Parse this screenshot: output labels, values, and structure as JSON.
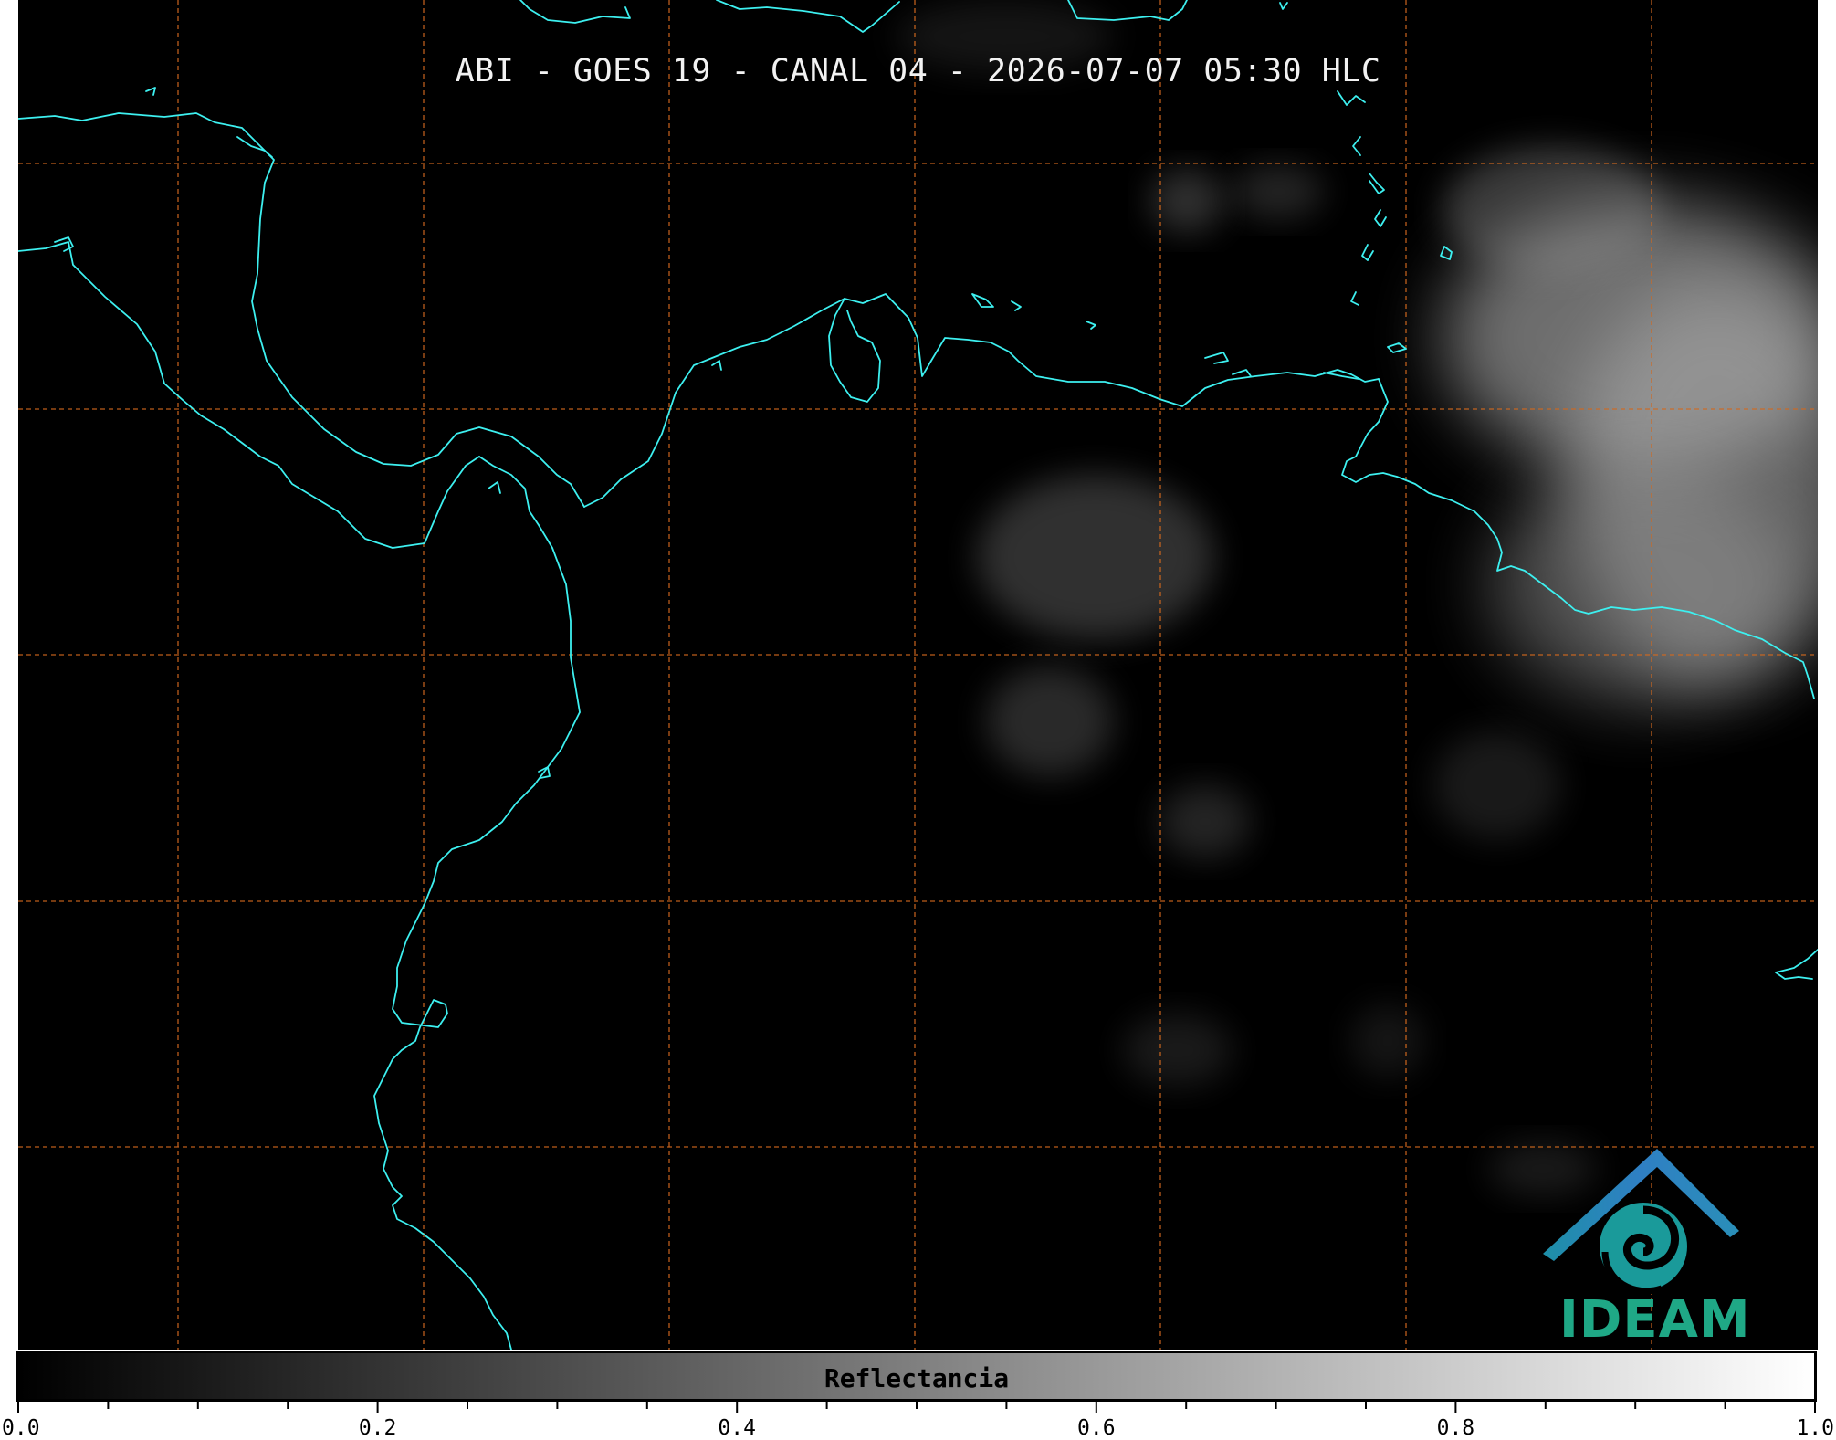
{
  "title": "ABI - GOES 19 - CANAL 04 - 2026-07-07 05:30 HLC",
  "colorbar": {
    "label": "Reflectancia",
    "range": [
      0.0,
      1.0
    ],
    "ticks": [
      "0.0",
      "0.2",
      "0.4",
      "0.6",
      "0.8",
      "1.0"
    ],
    "minor_tick_step": 0.05,
    "colormap": [
      "#000000",
      "#ffffff"
    ]
  },
  "logo": {
    "text": "IDEAM",
    "colors": {
      "roof": "#2f7fc4",
      "swirl": "#1fa886",
      "text": "#1fa886"
    }
  },
  "map": {
    "background": "#000000",
    "coastline_color": "#3df0f0",
    "gridline_color": "#d2691e",
    "gridline_style": "dashed",
    "cloud_color": "#bdbdbd"
  }
}
